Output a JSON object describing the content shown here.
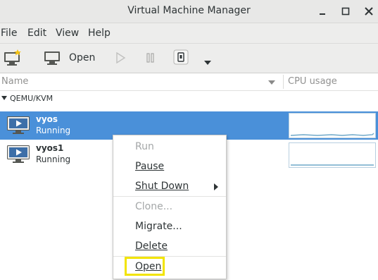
{
  "window": {
    "title": "Virtual Machine Manager"
  },
  "menubar": {
    "items": [
      "File",
      "Edit",
      "View",
      "Help"
    ]
  },
  "toolbar": {
    "open_label": "Open"
  },
  "columns": {
    "name": "Name",
    "cpu": "CPU usage"
  },
  "group": {
    "label": "QEMU/KVM"
  },
  "vms": [
    {
      "name": "vyos",
      "status": "Running",
      "selected": true
    },
    {
      "name": "vyos1",
      "status": "Running",
      "selected": false
    }
  ],
  "context_menu": {
    "items": [
      {
        "label": "Run",
        "enabled": false
      },
      {
        "label": "Pause",
        "enabled": true
      },
      {
        "label": "Shut Down",
        "enabled": true,
        "submenu": true
      },
      {
        "label": "Clone...",
        "enabled": false
      },
      {
        "label": "Migrate...",
        "enabled": true
      },
      {
        "label": "Delete",
        "enabled": true
      },
      {
        "label": "Open",
        "enabled": true,
        "highlighted": true
      }
    ]
  },
  "colors": {
    "selection": "#4a90d9",
    "highlight_box": "#f2e400",
    "graph_line": "#6fa9c9"
  }
}
